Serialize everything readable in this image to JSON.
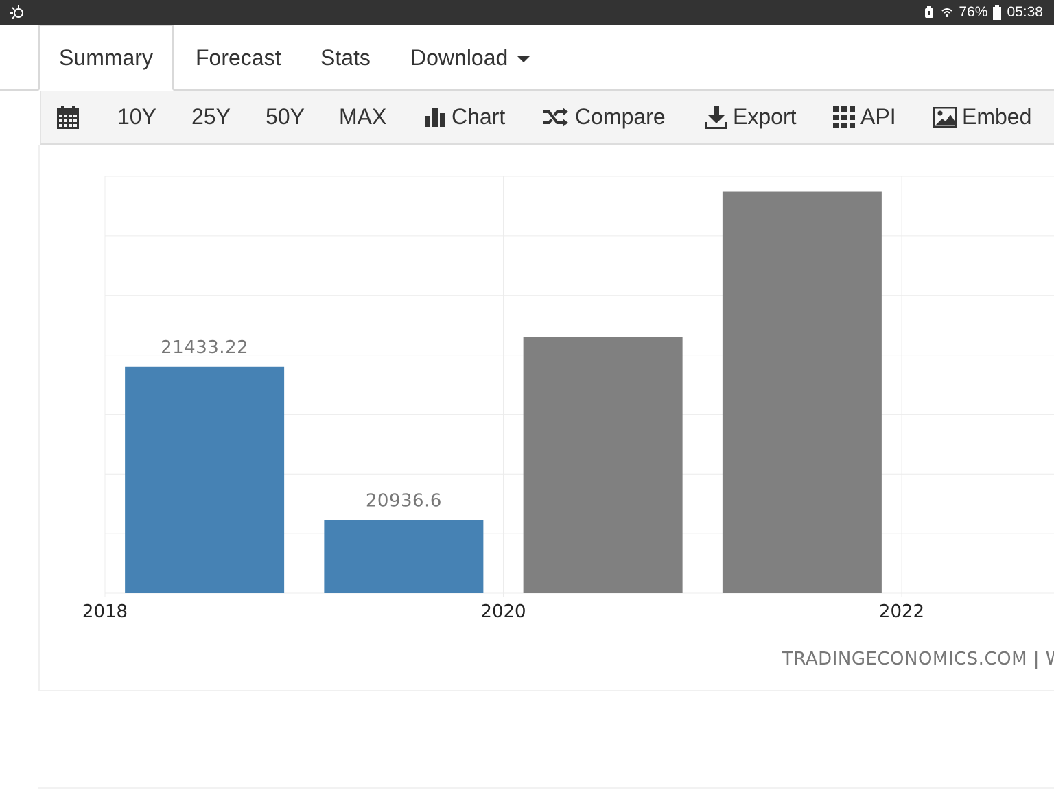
{
  "status_bar": {
    "battery_percent": "76%",
    "time": "05:38"
  },
  "tabs": [
    {
      "label": "Summary",
      "active": true
    },
    {
      "label": "Forecast",
      "active": false
    },
    {
      "label": "Stats",
      "active": false
    },
    {
      "label": "Download",
      "active": false
    }
  ],
  "toolbar": {
    "ranges": [
      "10Y",
      "25Y",
      "50Y",
      "MAX"
    ],
    "chart_label": "Chart",
    "compare_label": "Compare",
    "export_label": "Export",
    "api_label": "API",
    "embed_label": "Embed"
  },
  "chart_credit": "TRADINGECONOMICS.COM  |  WO",
  "colors": {
    "actual_bar": "#4682b4",
    "forecast_bar": "#808080",
    "status_bar": "#333333",
    "toolbar_bg": "#f4f4f4"
  },
  "chart_data": {
    "type": "bar",
    "x_ticks": [
      "2018",
      "2020",
      "2022"
    ],
    "series": [
      {
        "values": [
          {
            "year": 2019,
            "value": 21433.22,
            "label": "21433.22"
          },
          {
            "year": 2020,
            "value": 20936.6,
            "label": "20936.6"
          }
        ]
      },
      {
        "values": [
          {
            "year": 2021,
            "value": 21530
          },
          {
            "year": 2022,
            "value": 22000
          }
        ]
      }
    ],
    "xlim": [
      2018,
      2023
    ],
    "ylim": [
      20700,
      22050
    ],
    "grid": true
  }
}
